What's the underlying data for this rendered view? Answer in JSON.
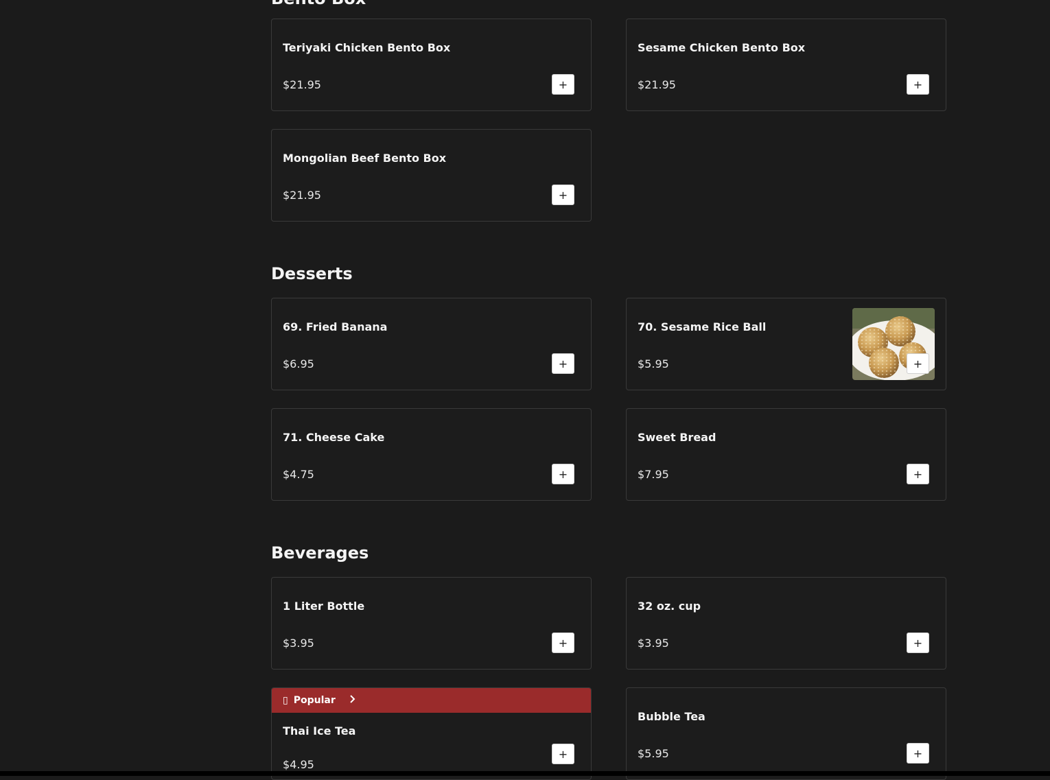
{
  "sections": {
    "bento": {
      "title": "Bento Box",
      "items": [
        {
          "name": "Teriyaki Chicken Bento Box",
          "price": "$21.95"
        },
        {
          "name": "Sesame Chicken Bento Box",
          "price": "$21.95"
        },
        {
          "name": "Mongolian Beef Bento Box",
          "price": "$21.95"
        }
      ]
    },
    "desserts": {
      "title": "Desserts",
      "items": [
        {
          "name": "69. Fried Banana",
          "price": "$6.95"
        },
        {
          "name": "70. Sesame Rice Ball",
          "price": "$5.95"
        },
        {
          "name": "71. Cheese Cake",
          "price": "$4.75"
        },
        {
          "name": "Sweet Bread",
          "price": "$7.95"
        }
      ]
    },
    "beverages": {
      "title": "Beverages",
      "items": [
        {
          "name": "1 Liter Bottle",
          "price": "$3.95"
        },
        {
          "name": "32 oz. cup",
          "price": "$3.95"
        },
        {
          "name": "Thai Ice Tea",
          "price": "$4.95",
          "badge": "Popular"
        },
        {
          "name": "Bubble Tea",
          "price": "$5.95"
        }
      ]
    }
  },
  "add_label": "+",
  "icons": {
    "add": "plus-icon",
    "popular": "fire-icon",
    "chevron": "chevron-right-icon"
  },
  "colors": {
    "background": "#1b1b1b",
    "popular_banner": "#9a2b2b",
    "card_border": "#3a3a3a"
  }
}
